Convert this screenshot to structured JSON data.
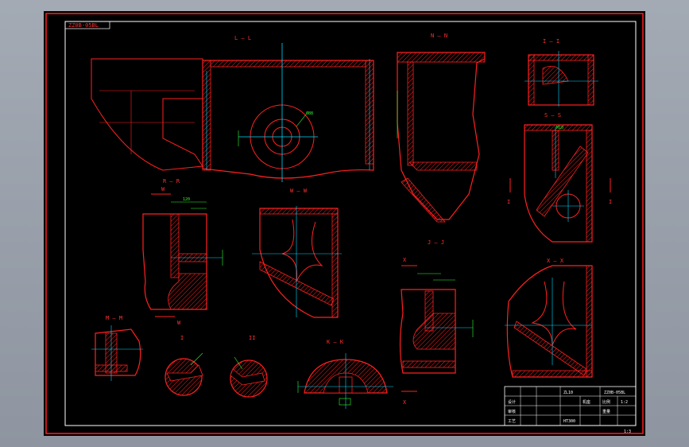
{
  "drawing": {
    "stamp": "ZZ0B-05BL",
    "sections": [
      {
        "id": "LL",
        "label": "L — L"
      },
      {
        "id": "NN",
        "label": "N — N"
      },
      {
        "id": "II_top",
        "label": "I — I"
      },
      {
        "id": "SS",
        "label": "S — S"
      },
      {
        "id": "RR",
        "label": "R — R"
      },
      {
        "id": "WW",
        "label": "W — W"
      },
      {
        "id": "W",
        "label": "W"
      },
      {
        "id": "JJ",
        "label": "J — J"
      },
      {
        "id": "XX",
        "label": "X — X"
      },
      {
        "id": "MM",
        "label": "M — M"
      },
      {
        "id": "KK",
        "label": "K — K"
      },
      {
        "id": "I_detail",
        "label": "I"
      },
      {
        "id": "II_detail",
        "label": "II"
      }
    ],
    "markers": {
      "X": "X",
      "W": "W",
      "I": "I",
      "Icap": "I"
    },
    "page_number": "1:3"
  },
  "title_block": {
    "code": "ZZ0B-05BL",
    "name": "机座",
    "material": "HT300",
    "cells": [
      "ZL10",
      "机座",
      "比例",
      "1:2",
      "重量",
      "设计",
      "审核",
      "工艺"
    ]
  },
  "colors": {
    "line": "#ff2020",
    "center": "#00d8ff",
    "dim": "#30ff30",
    "border": "#ff2020",
    "bg": "#000000"
  }
}
